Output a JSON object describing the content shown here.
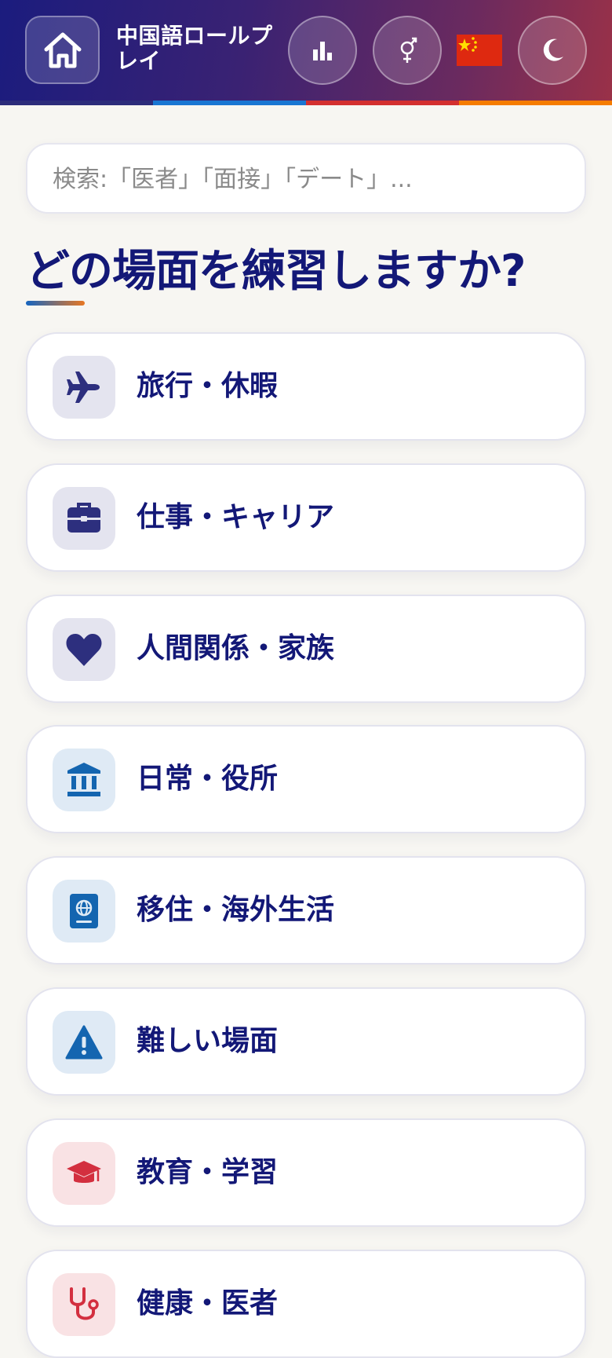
{
  "header": {
    "app_title": "中国語ロールプレイ",
    "buttons": [
      "home-icon",
      "bar-chart-icon",
      "gender-icon",
      "china-flag-icon",
      "moon-icon"
    ],
    "accent_colors": [
      "#2c2c7a",
      "#1976d2",
      "#d32f2f",
      "#f57c00"
    ]
  },
  "search": {
    "placeholder": "検索:「医者」「面接」「デート」..."
  },
  "main": {
    "heading": "どの場面を練習しますか?",
    "categories": [
      {
        "label": "旅行・休暇",
        "icon": "airplane-icon",
        "icon_color": "#2d2f7e",
        "icon_bg": "#e4e4ef"
      },
      {
        "label": "仕事・キャリア",
        "icon": "briefcase-icon",
        "icon_color": "#2d2f7e",
        "icon_bg": "#e4e4ef"
      },
      {
        "label": "人間関係・家族",
        "icon": "heart-icon",
        "icon_color": "#2d2f7e",
        "icon_bg": "#e4e4ef"
      },
      {
        "label": "日常・役所",
        "icon": "government-building-icon",
        "icon_color": "#1465b0",
        "icon_bg": "#dfeaf5"
      },
      {
        "label": "移住・海外生活",
        "icon": "passport-icon",
        "icon_color": "#1465b0",
        "icon_bg": "#dfeaf5"
      },
      {
        "label": "難しい場面",
        "icon": "warning-icon",
        "icon_color": "#1465b0",
        "icon_bg": "#dfeaf5"
      },
      {
        "label": "教育・学習",
        "icon": "graduation-cap-icon",
        "icon_color": "#d32f3f",
        "icon_bg": "#f9e2e4"
      },
      {
        "label": "健康・医者",
        "icon": "stethoscope-icon",
        "icon_color": "#d32f3f",
        "icon_bg": "#f9e2e4"
      }
    ]
  }
}
